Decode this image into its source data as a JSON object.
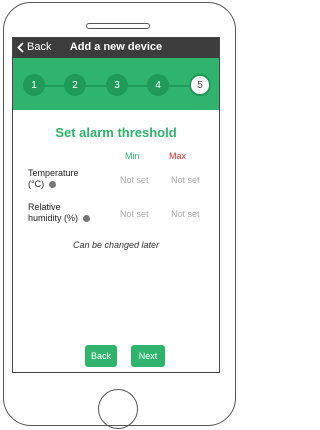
{
  "header": {
    "back_label": "Back",
    "title": "Add a new device"
  },
  "stepper": {
    "steps": [
      {
        "label": "1",
        "state": "done"
      },
      {
        "label": "2",
        "state": "done"
      },
      {
        "label": "3",
        "state": "done"
      },
      {
        "label": "4",
        "state": "done"
      },
      {
        "label": "5",
        "state": "current"
      }
    ]
  },
  "main": {
    "section_title": "Set alarm threshold",
    "col_min": "Min",
    "col_max": "Max",
    "rows": [
      {
        "label_line1": "Temperature",
        "label_line2": "(°C)",
        "min": "Not set",
        "max": "Not set"
      },
      {
        "label_line1": "Relative",
        "label_line2": "humidity (%)",
        "min": "Not set",
        "max": "Not set"
      }
    ],
    "hint": "Can be changed later"
  },
  "footer": {
    "back_button": "Back",
    "next_button": "Next"
  },
  "colors": {
    "accent_green": "#2eb46c",
    "max_red": "#d9301f",
    "appbar": "#3c3c3c"
  }
}
